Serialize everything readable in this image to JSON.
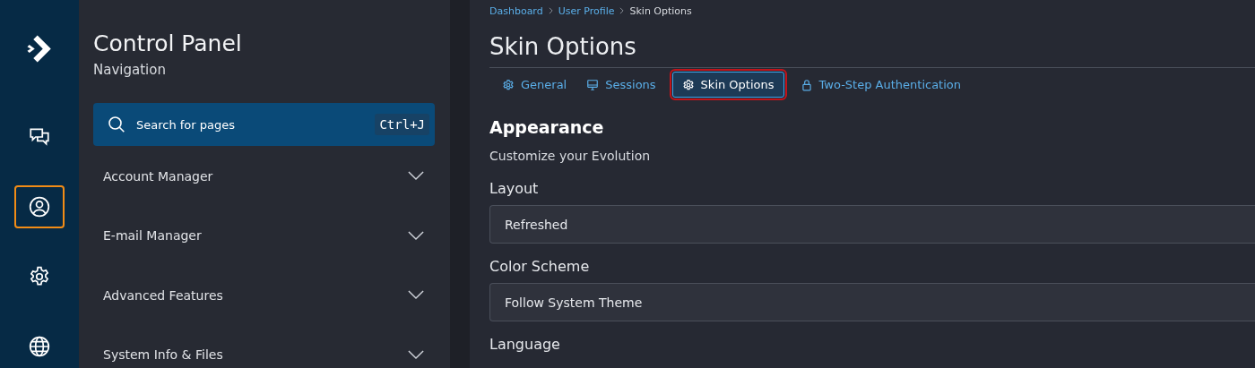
{
  "rail": {
    "items": [
      {
        "kind": "chat",
        "selected": false
      },
      {
        "kind": "user",
        "selected": true
      },
      {
        "kind": "gear",
        "selected": false
      },
      {
        "kind": "globe",
        "selected": false
      }
    ]
  },
  "sidebar": {
    "title": "Control Panel",
    "subtitle": "Navigation",
    "search": {
      "placeholder": "Search for pages",
      "shortcut": "Ctrl+J"
    },
    "items": [
      {
        "label": "Account Manager",
        "expanded": false
      },
      {
        "label": "E-mail Manager",
        "expanded": false
      },
      {
        "label": "Advanced Features",
        "expanded": false
      },
      {
        "label": "System Info & Files",
        "expanded": false
      }
    ]
  },
  "breadcrumb": [
    {
      "label": "Dashboard"
    },
    {
      "label": "User Profile"
    },
    {
      "label": "Skin Options"
    }
  ],
  "page_title": "Skin Options",
  "tabs": [
    {
      "label": "General",
      "kind": "gear",
      "selected": false
    },
    {
      "label": "Sessions",
      "kind": "monitor",
      "selected": false
    },
    {
      "label": "Skin Options",
      "kind": "gear",
      "selected": true
    },
    {
      "label": "Two-Step Authentication",
      "kind": "lock",
      "selected": false
    }
  ],
  "section": {
    "title": "Appearance",
    "description": "Customize your Evolution"
  },
  "fields": [
    {
      "label": "Layout",
      "value": "Refreshed"
    },
    {
      "label": "Color Scheme",
      "value": "Follow System Theme"
    },
    {
      "label": "Language"
    }
  ]
}
